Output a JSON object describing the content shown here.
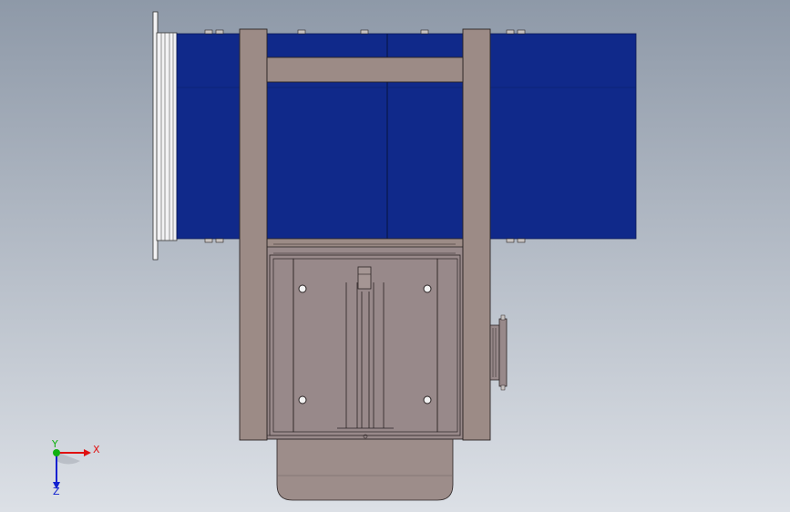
{
  "viewport": {
    "background_top": "#8e99a8",
    "background_bottom": "#dce0e6"
  },
  "model": {
    "conveyor_color": "#10298a",
    "frame_color": "#9c8b86",
    "frame_edge": "#2a2323",
    "housing_color": "#98898a",
    "motor_color": "#9d8d8a",
    "flange_color": "#f2f2f4",
    "bolt_color": "#c9c4c2"
  },
  "triad": {
    "x_label": "X",
    "y_label": "Y",
    "z_label": "Z",
    "x_color": "#e01010",
    "y_color": "#10b010",
    "z_color": "#1020d0"
  }
}
